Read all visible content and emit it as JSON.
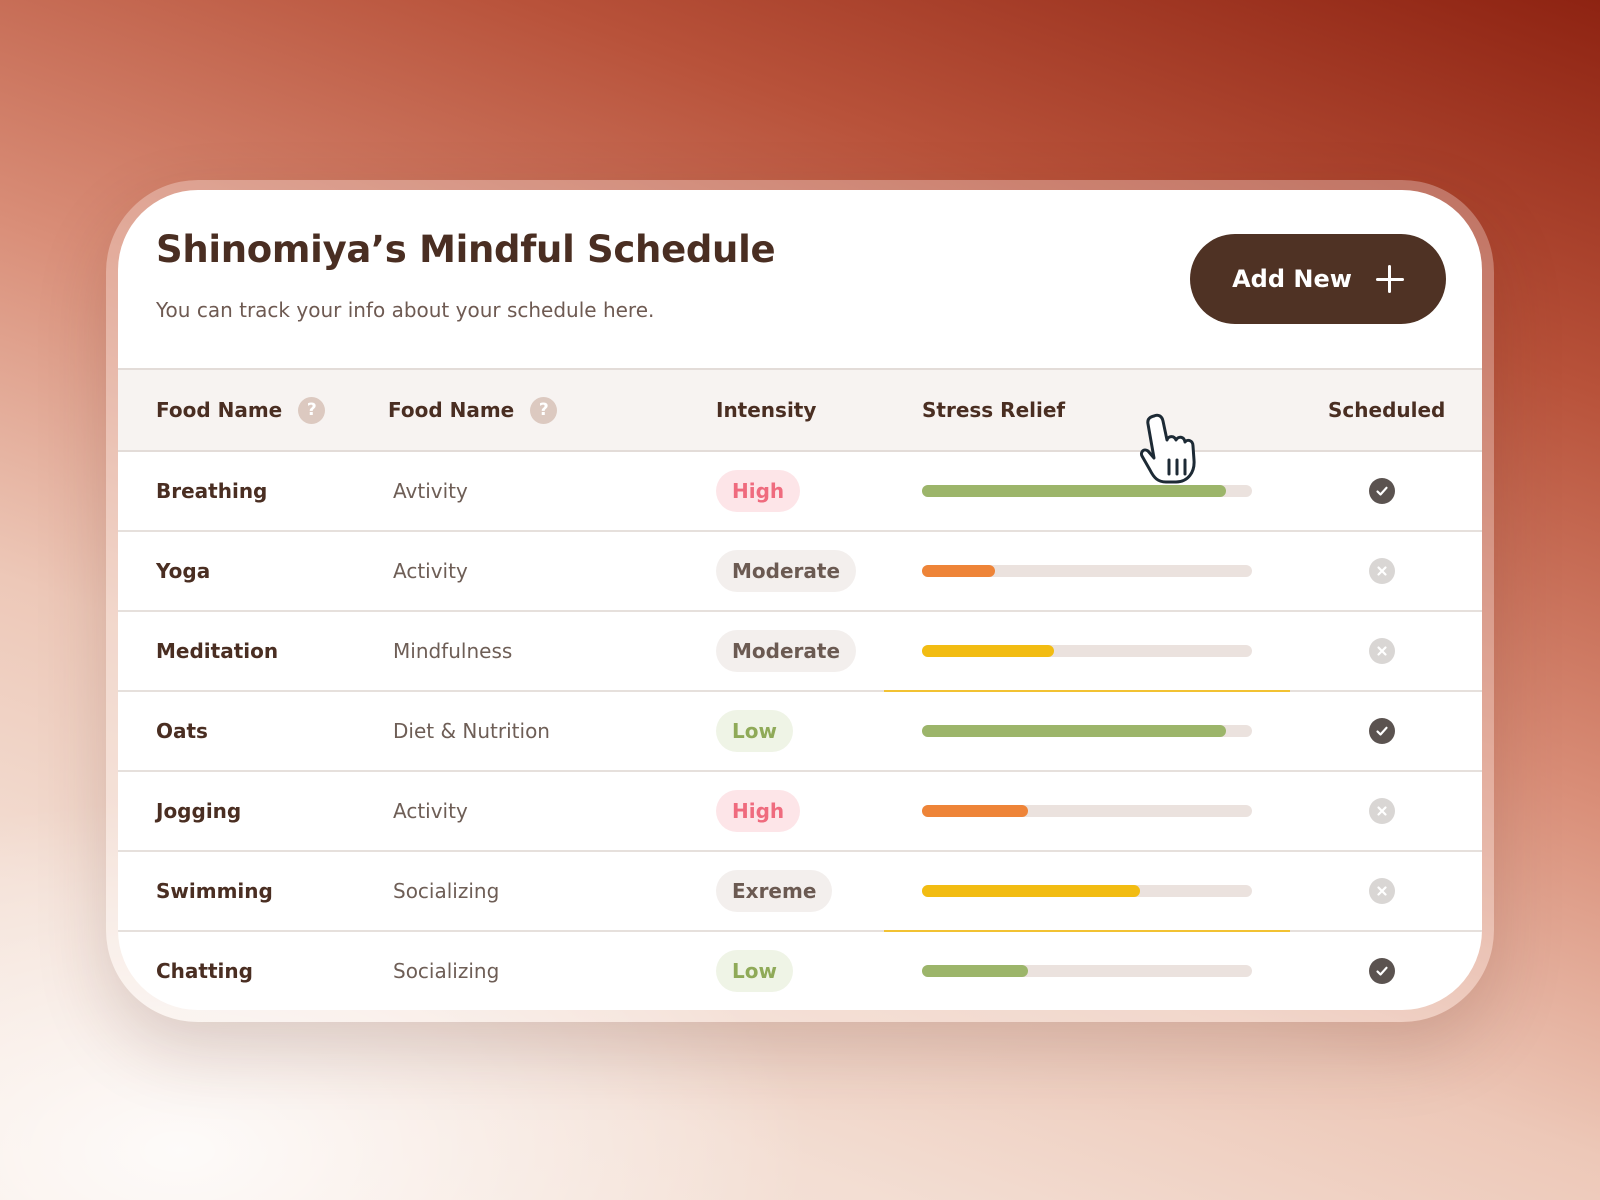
{
  "header": {
    "title": "Shinomiya’s Mindful Schedule",
    "subtitle": "You can track your info about your schedule here.",
    "add_button_label": "Add New"
  },
  "table": {
    "columns": [
      {
        "label": "Food Name",
        "help": "?"
      },
      {
        "label": "Food Name",
        "help": "?"
      },
      {
        "label": "Intensity"
      },
      {
        "label": "Stress Relief"
      },
      {
        "label": "Scheduled"
      }
    ],
    "rows": [
      {
        "name": "Breathing",
        "category": "Avtivity",
        "intensity": "High",
        "intensity_level": "high",
        "stress_relief": 0.92,
        "bar_color": "#9cb56a",
        "scheduled": true,
        "highlight": false
      },
      {
        "name": "Yoga",
        "category": "Activity",
        "intensity": "Moderate",
        "intensity_level": "moderate",
        "stress_relief": 0.22,
        "bar_color": "#ee8438",
        "scheduled": false,
        "highlight": false
      },
      {
        "name": "Meditation",
        "category": "Mindfulness",
        "intensity": "Moderate",
        "intensity_level": "moderate",
        "stress_relief": 0.4,
        "bar_color": "#f2bc12",
        "scheduled": false,
        "highlight": true
      },
      {
        "name": "Oats",
        "category": "Diet & Nutrition",
        "intensity": "Low",
        "intensity_level": "low",
        "stress_relief": 0.92,
        "bar_color": "#9cb56a",
        "scheduled": true,
        "highlight": false
      },
      {
        "name": "Jogging",
        "category": "Activity",
        "intensity": "High",
        "intensity_level": "high",
        "stress_relief": 0.32,
        "bar_color": "#ee8438",
        "scheduled": false,
        "highlight": false
      },
      {
        "name": "Swimming",
        "category": "Socializing",
        "intensity": "Exreme",
        "intensity_level": "extreme",
        "stress_relief": 0.66,
        "bar_color": "#f2bc12",
        "scheduled": false,
        "highlight": true
      },
      {
        "name": "Chatting",
        "category": "Socializing",
        "intensity": "Low",
        "intensity_level": "low",
        "stress_relief": 0.32,
        "bar_color": "#9cb56a",
        "scheduled": true,
        "highlight": false
      }
    ]
  },
  "icons": {
    "help": "question-circle-icon",
    "add": "plus-icon",
    "scheduled_on": "check-circle-icon",
    "scheduled_off": "x-circle-icon",
    "cursor": "hand-pointer-icon"
  },
  "colors": {
    "primary_button": "#4f3224",
    "title_text": "#4a2e22",
    "high": "#ef6b7e",
    "low": "#8faa58",
    "bar_green": "#9cb56a",
    "bar_orange": "#ee8438",
    "bar_yellow": "#f2bc12"
  }
}
